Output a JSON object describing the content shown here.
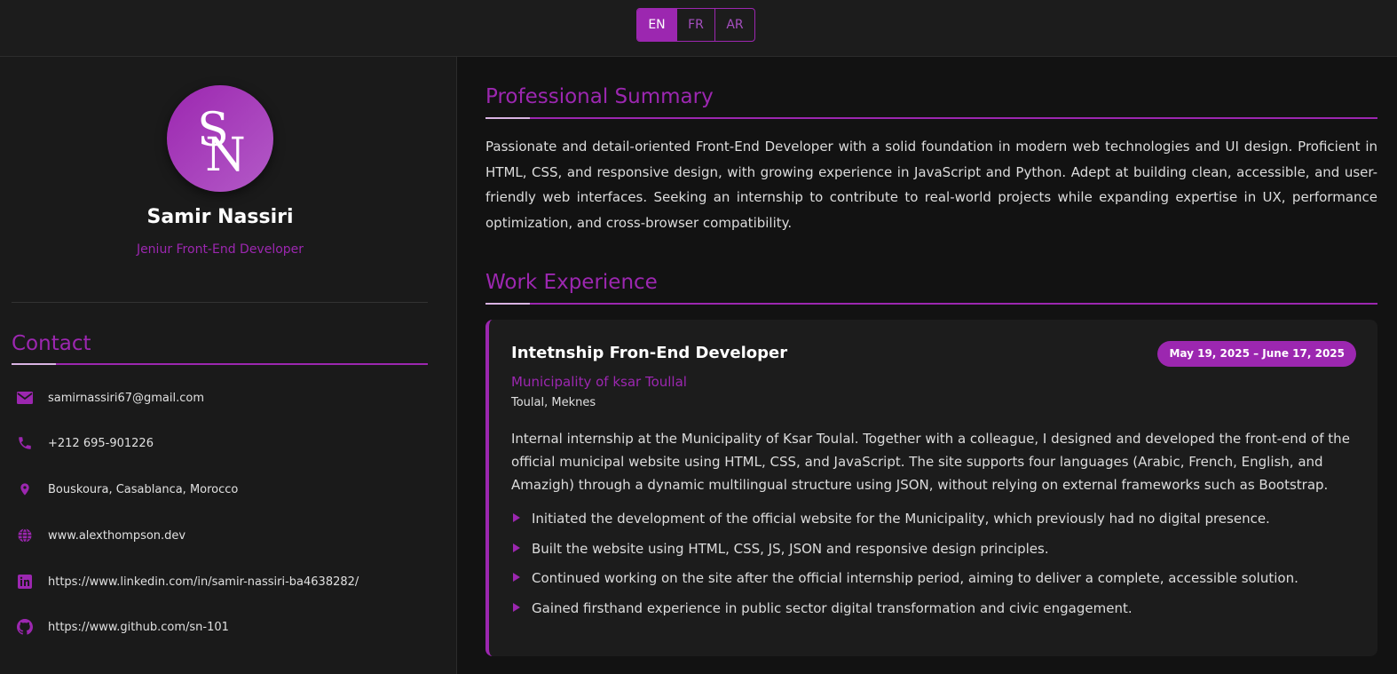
{
  "languages": [
    {
      "code": "EN",
      "active": true
    },
    {
      "code": "FR",
      "active": false
    },
    {
      "code": "AR",
      "active": false
    }
  ],
  "profile": {
    "name": "Samir Nassiri",
    "role": "Jeniur Front-End Developer",
    "avatar_monogram": "SN"
  },
  "contact": {
    "title": "Contact",
    "items": [
      {
        "icon": "email-icon",
        "text": "samirnassiri67@gmail.com"
      },
      {
        "icon": "phone-icon",
        "text": "+212 695-901226"
      },
      {
        "icon": "location-pin-icon",
        "text": "Bouskoura, Casablanca, Morocco"
      },
      {
        "icon": "globe-icon",
        "text": "www.alexthompson.dev"
      },
      {
        "icon": "linkedin-icon",
        "text": "https://www.linkedin.com/in/samir-nassiri-ba4638282/"
      },
      {
        "icon": "github-icon",
        "text": "https://www.github.com/sn-101"
      }
    ]
  },
  "summary": {
    "title": "Professional Summary",
    "text": "Passionate and detail-oriented Front-End Developer with a solid foundation in modern web technologies and UI design. Proficient in HTML, CSS, and responsive design, with growing experience in JavaScript and Python. Adept at building clean, accessible, and user-friendly web interfaces. Seeking an internship to contribute to real-world projects while expanding expertise in UX, performance optimization, and cross-browser compatibility."
  },
  "experience": {
    "title": "Work Experience",
    "jobs": [
      {
        "title": "Intetnship Fron-End Developer",
        "dates": "May 19, 2025 – June 17, 2025",
        "company": "Municipality of ksar Toullal",
        "location": "Toulal, Meknes",
        "description": "Internal internship at the Municipality of Ksar Toulal. Together with a colleague, I designed and developed the front-end of the official municipal website using HTML, CSS, and JavaScript. The site supports four languages (Arabic, French, English, and Amazigh) through a dynamic multilingual structure using JSON, without relying on external frameworks such as Bootstrap.",
        "bullets": [
          "Initiated the development of the official website for the Municipality, which previously had no digital presence.",
          "Built the website using HTML, CSS, JS, JSON and responsive design principles.",
          "Continued working on the site after the official internship period, aiming to deliver a complete, accessible solution.",
          "Gained firsthand experience in public sector digital transformation and civic engagement."
        ]
      }
    ]
  },
  "colors": {
    "accent": "#9c27b0",
    "background": "#121212",
    "panel": "#1a1a1a"
  }
}
